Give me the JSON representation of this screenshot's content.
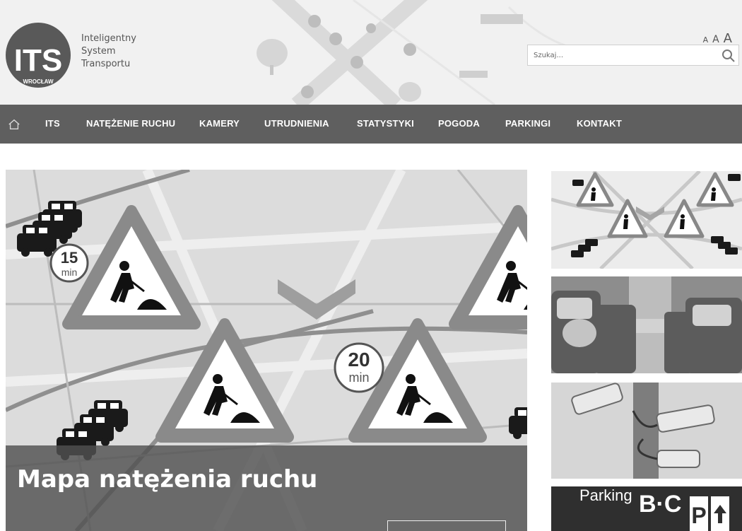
{
  "logo": {
    "mark": "ITS",
    "city": "WROCŁAW",
    "lines": [
      "Inteligentny",
      "System",
      "Transportu"
    ]
  },
  "font_sizer": [
    "A",
    "A",
    "A"
  ],
  "search": {
    "placeholder": "Szukaj..."
  },
  "nav": {
    "items": [
      "ITS",
      "NATĘŻENIE RUCHU",
      "KAMERY",
      "UTRUDNIENIA",
      "STATYSTYKI",
      "POGODA",
      "PARKINGI",
      "KONTAKT"
    ]
  },
  "hero": {
    "title": "Mapa natężenia ruchu",
    "badge_left": {
      "number": "15",
      "unit": "min"
    },
    "badge_right": {
      "number": "20",
      "unit": "min"
    }
  },
  "thumbs": {
    "parking": {
      "word": "Parking",
      "letters": "B·C"
    }
  },
  "colors": {
    "nav_bg": "#5f5f5f",
    "header_bg": "#f1f1f1",
    "caption_bg": "#505050"
  }
}
